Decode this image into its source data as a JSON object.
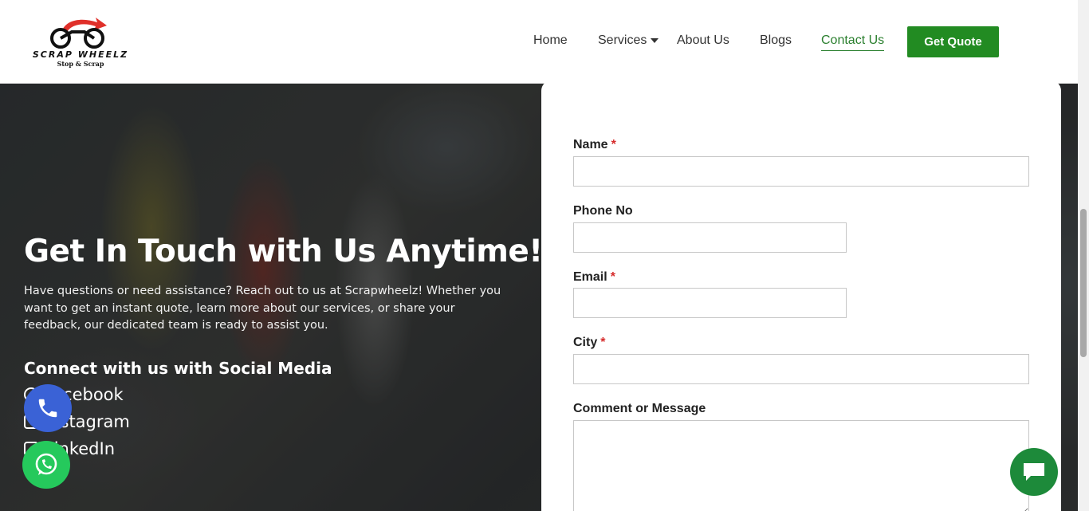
{
  "brand": {
    "name": "SCRAP WHEELZ",
    "tagline": "Stop & Scrap",
    "accent_color": "#228b22",
    "logo_red": "#e0302a"
  },
  "nav": {
    "items": [
      {
        "label": "Home"
      },
      {
        "label": "Services"
      },
      {
        "label": "About Us"
      },
      {
        "label": "Blogs"
      },
      {
        "label": "Contact Us",
        "active": true
      }
    ],
    "cta_label": "Get Quote"
  },
  "hero": {
    "title": "Get In Touch with Us Anytime!",
    "text": "Have questions or need assistance? Reach out to us at Scrapwheelz! Whether you want to get an instant quote, learn more about our services, or share your feedback, our dedicated team is ready to assist you.",
    "social_title": "Connect with us with Social Media",
    "social_links": [
      {
        "label": "Facebook",
        "icon": "facebook-icon"
      },
      {
        "label": "Instagram",
        "icon": "instagram-icon"
      },
      {
        "label": "LinkedIn",
        "icon": "linkedin-icon"
      }
    ]
  },
  "form": {
    "fields": {
      "name": {
        "label": "Name",
        "required": "*",
        "value": ""
      },
      "phone": {
        "label": "Phone No",
        "value": ""
      },
      "email": {
        "label": "Email",
        "required": "*",
        "value": ""
      },
      "city": {
        "label": "City",
        "required": "*",
        "value": ""
      },
      "message": {
        "label": "Comment or Message",
        "value": ""
      }
    }
  },
  "floating": {
    "call_icon": "phone-icon",
    "whatsapp_icon": "whatsapp-icon",
    "chat_icon": "chat-icon",
    "call_color": "#3a62d6",
    "whatsapp_color": "#25c95c",
    "chat_color": "#1d8a3a"
  }
}
